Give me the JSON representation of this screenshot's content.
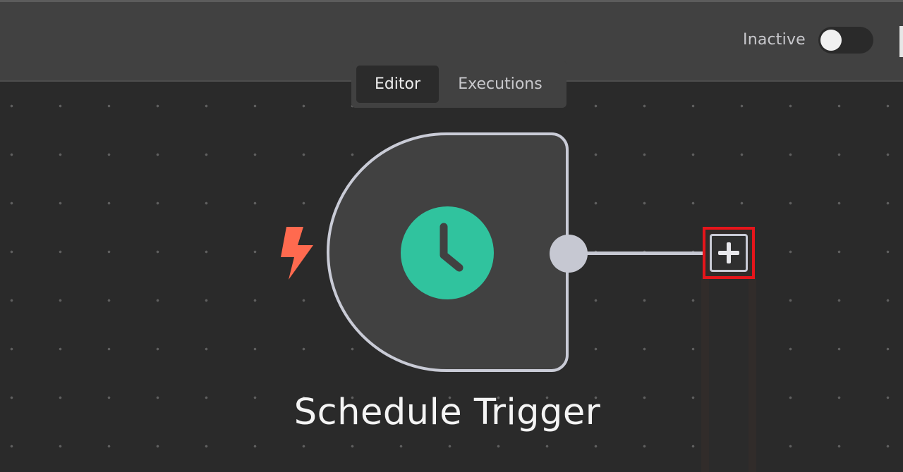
{
  "header": {
    "active_label": "Inactive",
    "active_toggle": {
      "state": "off"
    }
  },
  "tabs": [
    {
      "label": "Editor",
      "selected": true
    },
    {
      "label": "Executions",
      "selected": false
    }
  ],
  "node": {
    "label": "Schedule Trigger",
    "icon": "clock-icon",
    "trigger_icon": "lightning-bolt-icon"
  },
  "add_node": {
    "icon": "plus-icon"
  },
  "colors": {
    "background": "#2a2a2a",
    "topbar": "#414141",
    "node_fill": "#414141",
    "node_border": "#c9cbd6",
    "clock": "#30c39e",
    "bolt": "#ff6a4f",
    "highlight": "#e5151b"
  }
}
